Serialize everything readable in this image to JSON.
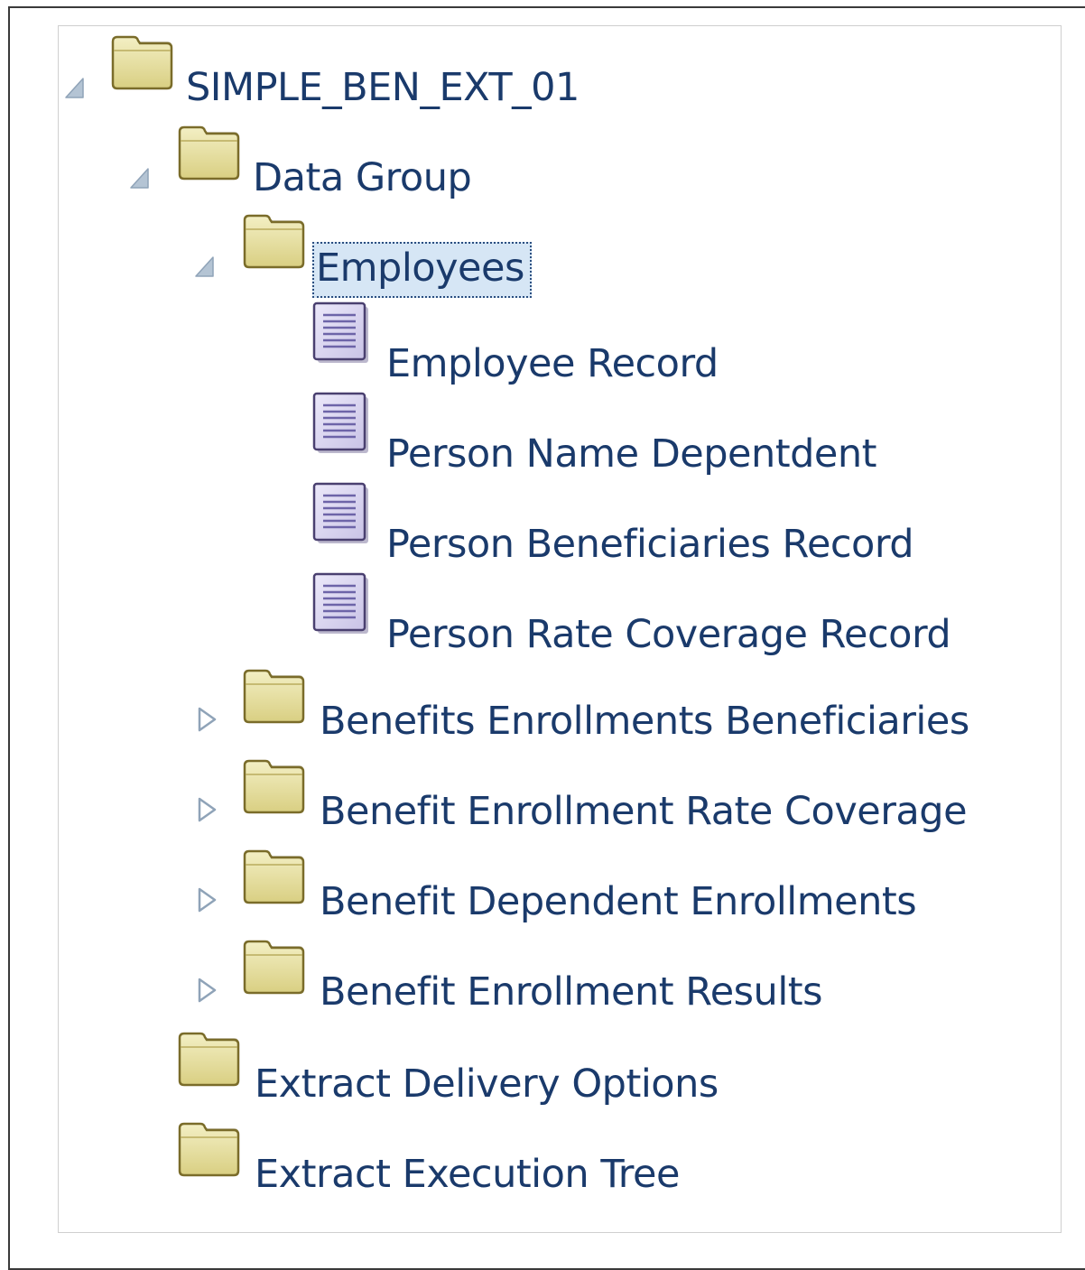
{
  "tree": {
    "root": {
      "label": "SIMPLE_BEN_EXT_01",
      "state": "expanded"
    },
    "data_group": {
      "label": "Data Group",
      "state": "expanded"
    },
    "employees": {
      "label": "Employees",
      "state": "expanded",
      "selected": true
    },
    "records": [
      {
        "label": "Employee Record"
      },
      {
        "label": "Person Name Depentdent"
      },
      {
        "label": "Person Beneficiaries Record"
      },
      {
        "label": "Person Rate Coverage Record"
      }
    ],
    "collapsed_groups": [
      {
        "label": "Benefits Enrollments Beneficiaries",
        "state": "collapsed"
      },
      {
        "label": "Benefit Enrollment Rate Coverage",
        "state": "collapsed"
      },
      {
        "label": "Benefit Dependent Enrollments",
        "state": "collapsed"
      },
      {
        "label": "Benefit Enrollment Results",
        "state": "collapsed"
      }
    ],
    "extract_delivery": {
      "label": "Extract Delivery Options"
    },
    "extract_execution": {
      "label": "Extract Execution Tree"
    }
  },
  "colors": {
    "label_text": "#1a3a6b",
    "selection_bg": "#d6e6f5",
    "folder_fill": "#e8e2a8",
    "folder_stroke": "#7a6c2a",
    "doc_fill": "#d9d5ef",
    "doc_stroke": "#4a4070",
    "expander": "#a8b8c8"
  }
}
